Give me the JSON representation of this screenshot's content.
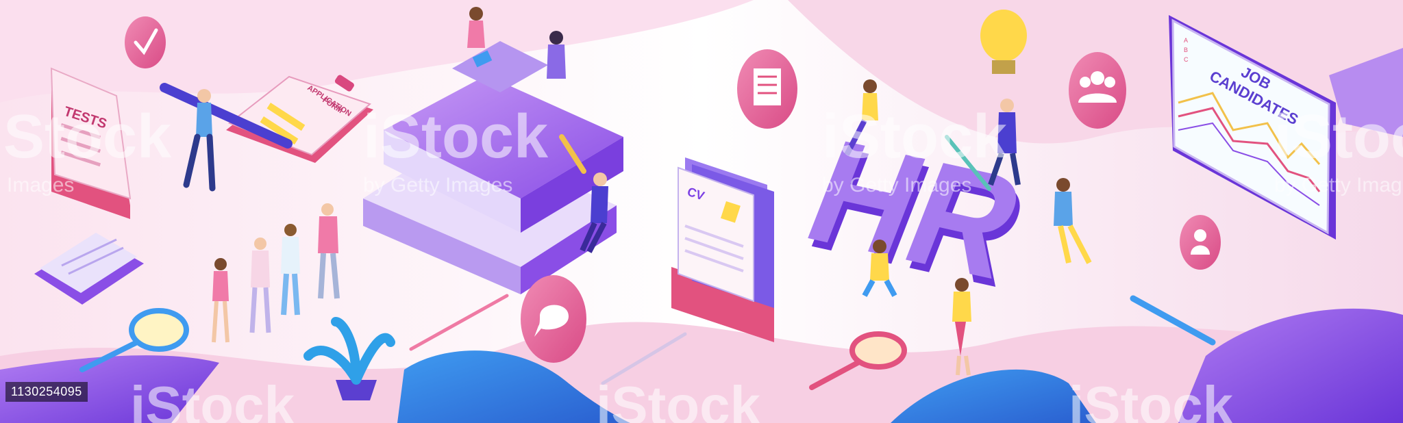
{
  "illustration": {
    "tests_label": "TESTS",
    "application_form_label_line1": "APPLICATION",
    "application_form_label_line2": "FORM",
    "cv_label": "CV",
    "hr_label": "HR",
    "job_candidates_line1": "JOB",
    "job_candidates_line2": "CANDIDATES",
    "chart_axis_letters": [
      "A",
      "B",
      "C"
    ]
  },
  "watermark": {
    "brand": "iStock",
    "credit": "by Getty Images",
    "credit_short": "Images",
    "stock_id": "1130254095"
  },
  "colors": {
    "purple": "#7b3fe4",
    "violet": "#9b59f0",
    "pink": "#e94e8a",
    "light_pink": "#f7d6e6",
    "blue": "#2f7de0",
    "yellow": "#ffd84a"
  }
}
